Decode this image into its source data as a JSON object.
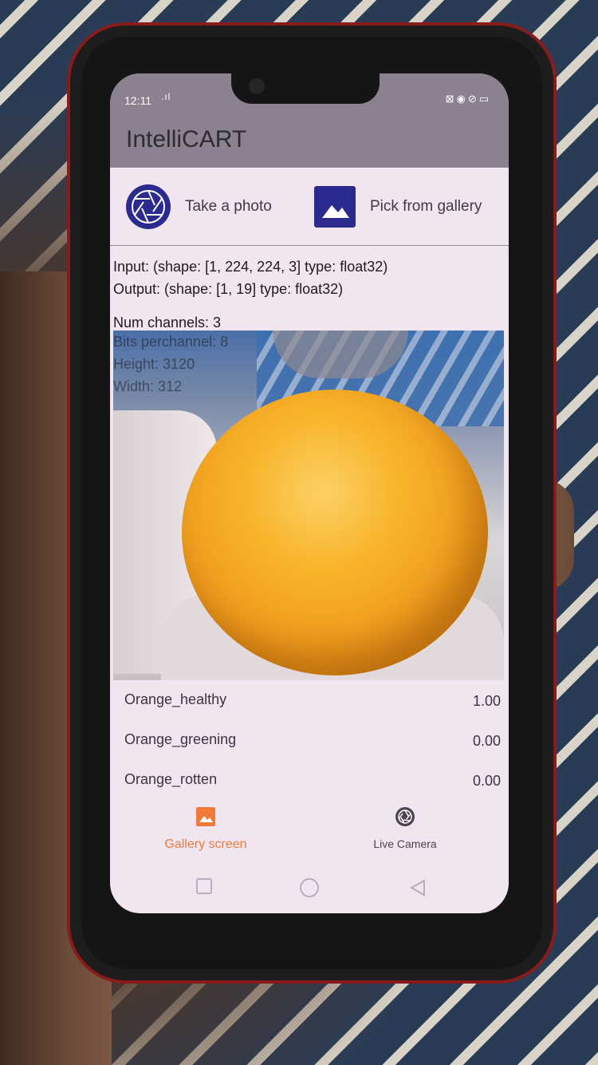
{
  "status_bar": {
    "time": "12:11",
    "signal_text": ".ıl",
    "right_icons": "⊠◉⊘▭"
  },
  "app_bar": {
    "title": "IntelliCART"
  },
  "actions": {
    "take_photo_label": "Take a photo",
    "take_photo_icon": "camera-aperture-icon",
    "pick_gallery_label": "Pick from gallery",
    "pick_gallery_icon": "image-icon",
    "icon_color": "#2b2a8f"
  },
  "model_info": {
    "input": "Input: (shape: [1, 224, 224, 3] type: float32)",
    "output": "Output: (shape: [1, 19] type: float32)",
    "num_channels": "Num channels: 3",
    "bits_per_channel": "Bits perchannel: 8",
    "height": "Height: 3120",
    "width": "Width: 312"
  },
  "results": [
    {
      "label": "Orange_healthy",
      "value": "1.00"
    },
    {
      "label": "Orange_greening",
      "value": "0.00"
    },
    {
      "label": "Orange_rotten",
      "value": "0.00"
    }
  ],
  "bottom_nav": {
    "gallery_label": "Gallery screen",
    "gallery_icon": "image-icon",
    "camera_label": "Live Camera",
    "camera_icon": "camera-aperture-icon",
    "active_color": "#f07a3a"
  },
  "system_nav": {
    "recents_icon": "square-icon",
    "home_icon": "circle-icon",
    "back_icon": "triangle-back-icon"
  }
}
